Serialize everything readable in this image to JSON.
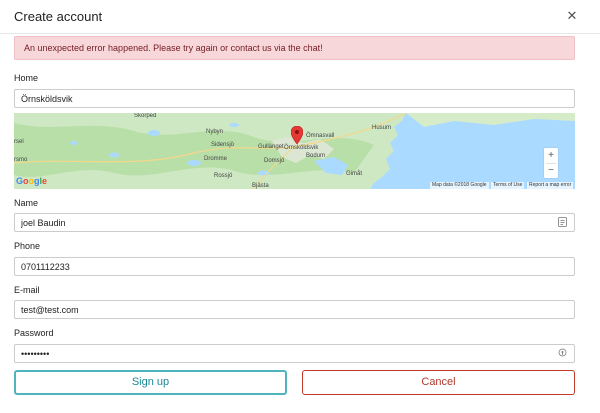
{
  "dialog": {
    "title": "Create account",
    "close_icon": "close-icon"
  },
  "alert": {
    "message": "An unexpected error happened. Please try again or contact us via the chat!",
    "color": "#f8d7da"
  },
  "home": {
    "label": "Home",
    "value": "Örnsköldsvik"
  },
  "map": {
    "places": [
      "Skorped",
      "Nybyn",
      "Sidensjö",
      "Dromme",
      "Rossjö",
      "Bjästa",
      "Domsjö",
      "Örnsköldsvik",
      "Gullänget",
      "Husum",
      "Bodum",
      "Gimåt",
      "rsel",
      "rsmo",
      "Ömnasvall"
    ],
    "zoom_in": "+",
    "zoom_out": "−",
    "logo": "Google",
    "map_data": "Map data ©2018 Google",
    "terms": "Terms of Use",
    "report": "Report a map error"
  },
  "name": {
    "label": "Name",
    "value": "joel Baudin"
  },
  "phone": {
    "label": "Phone",
    "value": "0701112233"
  },
  "email": {
    "label": "E-mail",
    "value": "test@test.com"
  },
  "password": {
    "label": "Password",
    "value": "•••••••••"
  },
  "buttons": {
    "signup": "Sign up",
    "cancel": "Cancel"
  },
  "colors": {
    "primary": "#50b4bd",
    "danger": "#c0392b"
  }
}
